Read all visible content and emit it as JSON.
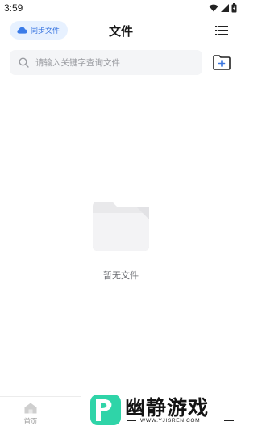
{
  "status_bar": {
    "time": "3:59",
    "icons": [
      "wifi-icon",
      "signal-icon",
      "battery-icon"
    ]
  },
  "header": {
    "sync_button_label": "同步文件",
    "title": "文件",
    "menu_icon": "list-menu-icon"
  },
  "search": {
    "placeholder": "请输入关键字查询文件",
    "value": ""
  },
  "toolbar": {
    "add_folder_icon": "add-folder-icon"
  },
  "empty_state": {
    "icon": "folder-icon",
    "message": "暂无文件"
  },
  "bottom_nav": {
    "items": [
      {
        "label": "首页",
        "icon": "home-icon"
      }
    ]
  },
  "watermark": {
    "title": "幽静游戏",
    "url": "WWW.YJISREN.COM"
  },
  "colors": {
    "accent": "#3a76e0",
    "sync_bg": "#e7f1ff",
    "search_bg": "#f4f5f7",
    "logo_green": "#2fd4a8"
  }
}
